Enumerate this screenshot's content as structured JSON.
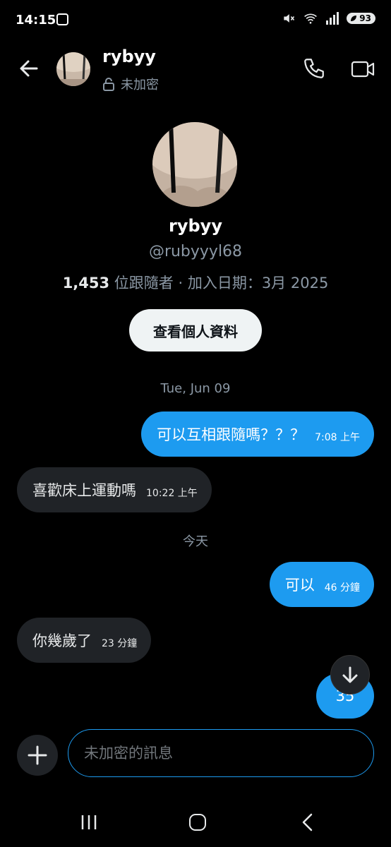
{
  "status_bar": {
    "time": "14:15",
    "battery": "93"
  },
  "header": {
    "name": "rybyy",
    "encryption": "未加密"
  },
  "profile": {
    "name": "rybyy",
    "handle": "@rubyyyl68",
    "followers_count": "1,453",
    "meta": " 位跟隨者 · 加入日期：3月 2025",
    "view_profile_label": "查看個人資料"
  },
  "conversation": {
    "date_1": "Tue, Jun 09",
    "date_2": "今天",
    "messages": [
      {
        "direction": "out",
        "text": "可以互相跟隨嗎？？？",
        "time": "7:08 上午"
      },
      {
        "direction": "in",
        "text": "喜歡床上運動嗎",
        "time": "10:22 上午"
      },
      {
        "direction": "out",
        "text": "可以",
        "time": "46 分鐘"
      },
      {
        "direction": "in",
        "text": "你幾歲了",
        "time": "23 分鐘"
      },
      {
        "direction": "out",
        "text": "35",
        "time": ""
      }
    ]
  },
  "composer": {
    "placeholder": "未加密的訊息"
  },
  "colors": {
    "accent": "#1d9bf0",
    "incoming_bubble": "#202327",
    "background": "#000000"
  },
  "icons": [
    "back-arrow-icon",
    "unlock-icon",
    "phone-icon",
    "video-icon",
    "arrow-down-icon",
    "plus-icon",
    "wifi-icon",
    "signal-icon",
    "mute-icon"
  ]
}
